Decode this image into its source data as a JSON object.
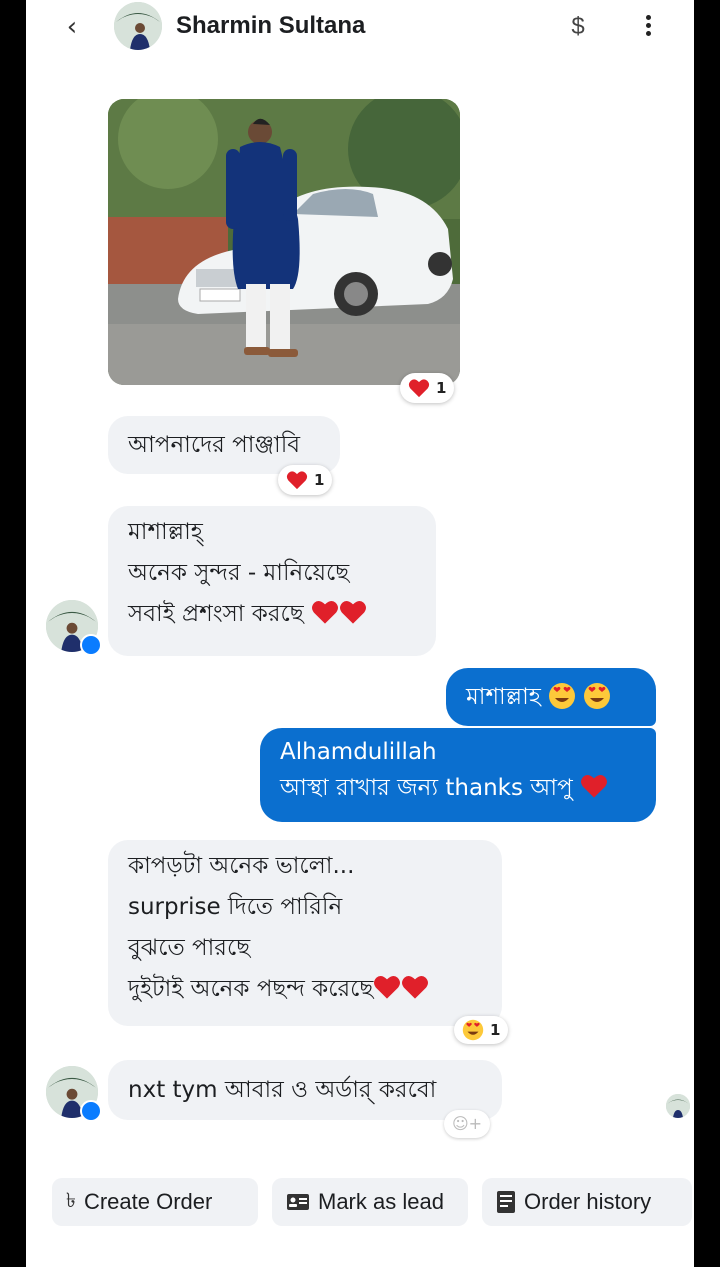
{
  "header": {
    "back_icon": "‹",
    "contact_name": "Sharmin Sultana",
    "dollar_icon": "$"
  },
  "messages": {
    "photo_reaction_count": "1",
    "m1": {
      "text": "আপনাদের পাঞ্জাবি",
      "reaction_count": "1"
    },
    "m2": {
      "lines": [
        "মাশাল্লাহ্",
        "অনেক সুন্দর - মানিয়েছে",
        "সবাই প্রশংসা করছে"
      ]
    },
    "m3": {
      "text": "মাশাল্লাহ"
    },
    "m4": {
      "lines": [
        "Alhamdulillah",
        "আস্থা রাখার জন্য thanks আপু"
      ]
    },
    "m5": {
      "lines": [
        "কাপড়টা অনেক ভালো...",
        "surprise দিতে পারিনি",
        "বুঝতে পারছে",
        "দুইটাই অনেক পছন্দ করেছে"
      ],
      "reaction_count": "1"
    },
    "m6": {
      "text": "nxt tym আবার ও অর্ডার্ করবো"
    }
  },
  "actions": {
    "create_order": "Create Order",
    "create_order_icon": "৳",
    "mark_as_lead": "Mark as lead",
    "order_history": "Order history"
  },
  "colors": {
    "outgoing_bubble": "#0b6fcf",
    "incoming_bubble": "#f0f2f5",
    "heart": "#e0202a"
  }
}
